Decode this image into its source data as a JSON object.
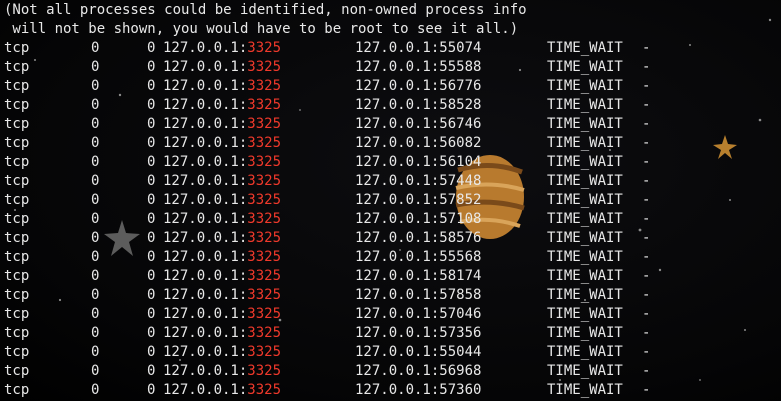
{
  "terminal": {
    "warning_lines": [
      "(Not all processes could be identified, non-owned process info",
      " will not be shown, you would have to be root to see it all.)"
    ],
    "highlight_color": "#f0392b",
    "text_color": "#e8e8e8",
    "rows": [
      {
        "proto": "tcp",
        "recvq": "0",
        "sendq": "0",
        "local_ip": "127.0.0.1:",
        "local_port": "3325",
        "foreign": "127.0.0.1:55074",
        "state": "TIME_WAIT",
        "pid": "-"
      },
      {
        "proto": "tcp",
        "recvq": "0",
        "sendq": "0",
        "local_ip": "127.0.0.1:",
        "local_port": "3325",
        "foreign": "127.0.0.1:55588",
        "state": "TIME_WAIT",
        "pid": "-"
      },
      {
        "proto": "tcp",
        "recvq": "0",
        "sendq": "0",
        "local_ip": "127.0.0.1:",
        "local_port": "3325",
        "foreign": "127.0.0.1:56776",
        "state": "TIME_WAIT",
        "pid": "-"
      },
      {
        "proto": "tcp",
        "recvq": "0",
        "sendq": "0",
        "local_ip": "127.0.0.1:",
        "local_port": "3325",
        "foreign": "127.0.0.1:58528",
        "state": "TIME_WAIT",
        "pid": "-"
      },
      {
        "proto": "tcp",
        "recvq": "0",
        "sendq": "0",
        "local_ip": "127.0.0.1:",
        "local_port": "3325",
        "foreign": "127.0.0.1:56746",
        "state": "TIME_WAIT",
        "pid": "-"
      },
      {
        "proto": "tcp",
        "recvq": "0",
        "sendq": "0",
        "local_ip": "127.0.0.1:",
        "local_port": "3325",
        "foreign": "127.0.0.1:56082",
        "state": "TIME_WAIT",
        "pid": "-"
      },
      {
        "proto": "tcp",
        "recvq": "0",
        "sendq": "0",
        "local_ip": "127.0.0.1:",
        "local_port": "3325",
        "foreign": "127.0.0.1:56104",
        "state": "TIME_WAIT",
        "pid": "-"
      },
      {
        "proto": "tcp",
        "recvq": "0",
        "sendq": "0",
        "local_ip": "127.0.0.1:",
        "local_port": "3325",
        "foreign": "127.0.0.1:57448",
        "state": "TIME_WAIT",
        "pid": "-"
      },
      {
        "proto": "tcp",
        "recvq": "0",
        "sendq": "0",
        "local_ip": "127.0.0.1:",
        "local_port": "3325",
        "foreign": "127.0.0.1:57852",
        "state": "TIME_WAIT",
        "pid": "-"
      },
      {
        "proto": "tcp",
        "recvq": "0",
        "sendq": "0",
        "local_ip": "127.0.0.1:",
        "local_port": "3325",
        "foreign": "127.0.0.1:57108",
        "state": "TIME_WAIT",
        "pid": "-"
      },
      {
        "proto": "tcp",
        "recvq": "0",
        "sendq": "0",
        "local_ip": "127.0.0.1:",
        "local_port": "3325",
        "foreign": "127.0.0.1:58576",
        "state": "TIME_WAIT",
        "pid": "-"
      },
      {
        "proto": "tcp",
        "recvq": "0",
        "sendq": "0",
        "local_ip": "127.0.0.1:",
        "local_port": "3325",
        "foreign": "127.0.0.1:55568",
        "state": "TIME_WAIT",
        "pid": "-"
      },
      {
        "proto": "tcp",
        "recvq": "0",
        "sendq": "0",
        "local_ip": "127.0.0.1:",
        "local_port": "3325",
        "foreign": "127.0.0.1:58174",
        "state": "TIME_WAIT",
        "pid": "-"
      },
      {
        "proto": "tcp",
        "recvq": "0",
        "sendq": "0",
        "local_ip": "127.0.0.1:",
        "local_port": "3325",
        "foreign": "127.0.0.1:57858",
        "state": "TIME_WAIT",
        "pid": "-"
      },
      {
        "proto": "tcp",
        "recvq": "0",
        "sendq": "0",
        "local_ip": "127.0.0.1:",
        "local_port": "3325",
        "foreign": "127.0.0.1:57046",
        "state": "TIME_WAIT",
        "pid": "-"
      },
      {
        "proto": "tcp",
        "recvq": "0",
        "sendq": "0",
        "local_ip": "127.0.0.1:",
        "local_port": "3325",
        "foreign": "127.0.0.1:57356",
        "state": "TIME_WAIT",
        "pid": "-"
      },
      {
        "proto": "tcp",
        "recvq": "0",
        "sendq": "0",
        "local_ip": "127.0.0.1:",
        "local_port": "3325",
        "foreign": "127.0.0.1:55044",
        "state": "TIME_WAIT",
        "pid": "-"
      },
      {
        "proto": "tcp",
        "recvq": "0",
        "sendq": "0",
        "local_ip": "127.0.0.1:",
        "local_port": "3325",
        "foreign": "127.0.0.1:56968",
        "state": "TIME_WAIT",
        "pid": "-"
      },
      {
        "proto": "tcp",
        "recvq": "0",
        "sendq": "0",
        "local_ip": "127.0.0.1:",
        "local_port": "3325",
        "foreign": "127.0.0.1:57360",
        "state": "TIME_WAIT",
        "pid": "-"
      }
    ]
  }
}
